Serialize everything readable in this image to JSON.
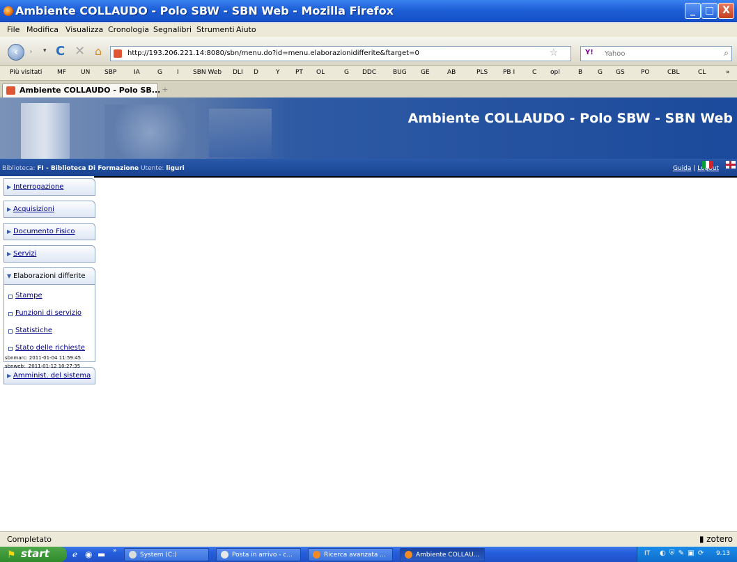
{
  "window": {
    "title": "Ambiente COLLAUDO - Polo SBW - SBN Web - Mozilla Firefox",
    "minimize": "_",
    "maximize": "□",
    "close": "X"
  },
  "menubar": [
    "File",
    "Modifica",
    "Visualizza",
    "Cronologia",
    "Segnalibri",
    "Strumenti",
    "Aiuto"
  ],
  "navigation": {
    "url": "http://193.206.221.14:8080/sbn/menu.do?id=menu.elaborazionidifferite&ftarget=0",
    "search_engine": "Y!",
    "search_placeholder": "Yahoo"
  },
  "bookmarks": [
    "Più visitati",
    "MF",
    "UN",
    "SBP",
    "IA",
    "G",
    "I",
    "SBN Web",
    "DLI",
    "D",
    "Y",
    "PT",
    "OL",
    "G",
    "DDC",
    "BUG",
    "GE",
    "AB",
    "PLS",
    "PB I",
    "C",
    "opl",
    "B",
    "G",
    "GS",
    "PO",
    "CBL",
    "CL",
    "»"
  ],
  "tab": {
    "label": "Ambiente COLLAUDO - Polo SB...",
    "new_tab": "+"
  },
  "banner": {
    "headline": "Ambiente COLLAUDO - Polo SBW - SBN Web",
    "biblioteca_label": "Biblioteca:",
    "biblioteca_value": "FI - Biblioteca Di Formazione",
    "utente_label": "Utente:",
    "utente_value": "liguri",
    "guida": "Guida",
    "separator": "|",
    "logout": "Logout"
  },
  "menu": {
    "items": [
      {
        "label": "Interrogazione"
      },
      {
        "label": "Acquisizioni"
      },
      {
        "label": "Documento Fisico"
      },
      {
        "label": "Servizi"
      },
      {
        "label": "Elaborazioni differite"
      },
      {
        "label": "Amminist. del sistema"
      }
    ],
    "subitems": [
      {
        "label": "Stampe"
      },
      {
        "label": "Funzioni di servizio"
      },
      {
        "label": "Statistiche"
      },
      {
        "label": "Stato delle richieste"
      }
    ]
  },
  "last_logins": [
    "sbnmarc: 2011-01-04 11:59:45",
    "sbnweb:  2011-01-12 10:27:35"
  ],
  "statusbar": {
    "text": "Completato",
    "zotero": "zotero"
  },
  "taskbar": {
    "start": "start",
    "overflow": "»",
    "tasks": [
      {
        "label": "System (C:)"
      },
      {
        "label": "Posta in arrivo - c..."
      },
      {
        "label": "Ricerca avanzata ..."
      },
      {
        "label": "Ambiente COLLAU..."
      }
    ],
    "lang": "IT",
    "clock": "9.13"
  }
}
